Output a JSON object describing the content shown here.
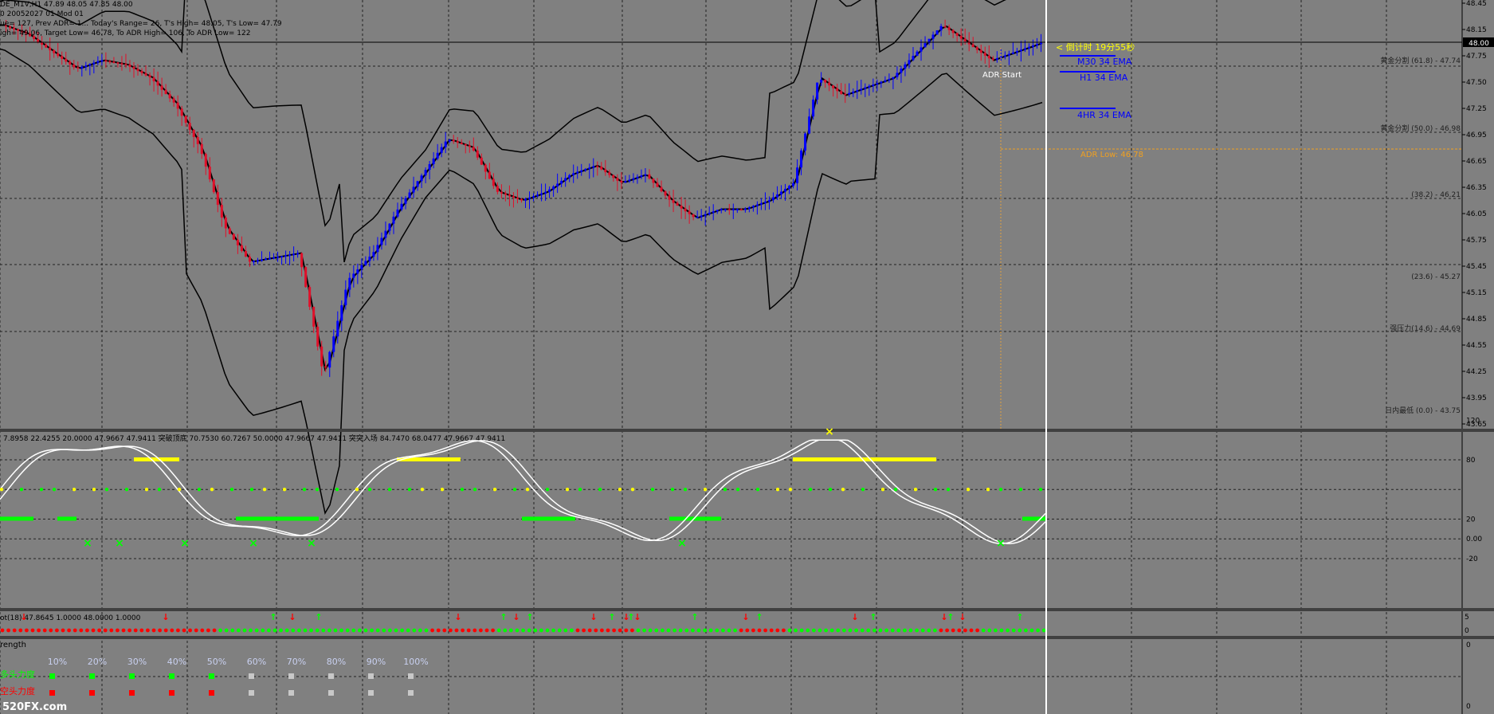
{
  "header": {
    "line1": "DE_M1V,H1  47.89 48.05 47.85 48.00",
    "line2": "0 20052027 01 Mod 01",
    "line3": "ue= 127, Prev ADR= 1... Today's Range= 26, T's High= 48.05, T's Low= 47.79",
    "line4": "igh= 49.06, Target Low= 46.78, To ADR High= 106, To ADR Low= 122"
  },
  "price_axis": {
    "ticks": [
      "48.45",
      "48.15",
      "47.75",
      "47.50",
      "47.25",
      "46.95",
      "46.65",
      "46.35",
      "46.05",
      "45.75",
      "45.45",
      "45.15",
      "44.85",
      "44.55",
      "44.25",
      "43.95",
      "43.65"
    ],
    "current": "48.00"
  },
  "annotations": {
    "countdown": "< 倒计时 19分55秒",
    "m30": "M30 34 EMA",
    "h1": "H1 34 EMA",
    "h4": "4HR 34 EMA",
    "adr_start": "ADR Start",
    "adr_low": "ADR Low: 46.78",
    "fib1": "黄金分割 (61.8) - 47.74",
    "fib2": "黄金分割 (50.0) - 46.98",
    "fib3": "(38.2) - 46.21",
    "fib4": "(23.6) - 45.27",
    "fib5": "强压力(14.6) - 44.69",
    "fib6": "日内最低 (0.0) - 43.75"
  },
  "stoch": {
    "header": "7.8958 22.4255 20.0000 47.9667 47.9411  突破顶底 70.7530 60.7267 50.0000 47.9667 47.9411  突突入场 84.7470 68.0477 47.9667 47.9411",
    "ticks": [
      "120",
      "80",
      "20",
      "0.00",
      "-20"
    ]
  },
  "dots": {
    "header": "ot(18) 47.8645 1.0000 48.0000 1.0000",
    "ticks": [
      "5",
      "0"
    ]
  },
  "strength": {
    "title": "rength",
    "percents": [
      "10%",
      "20%",
      "30%",
      "40%",
      "50%",
      "60%",
      "70%",
      "80%",
      "90%",
      "100%"
    ],
    "bull_label": "多头力度",
    "bear_label": "空头力度",
    "tick_top": "0",
    "tick_bottom": "0",
    "bull_colors": [
      "#00ff00",
      "#00ff00",
      "#00ff00",
      "#00ff00",
      "#00ff00",
      "#c8c8c8",
      "#c8c8c8",
      "#c8c8c8",
      "#c8c8c8",
      "#c8c8c8"
    ],
    "bear_colors": [
      "#ff0000",
      "#ff0000",
      "#ff0000",
      "#ff0000",
      "#ff0000",
      "#c8c8c8",
      "#c8c8c8",
      "#c8c8c8",
      "#c8c8c8",
      "#c8c8c8"
    ]
  },
  "watermark": "520FX.com",
  "colors": {
    "bull": "#0000ff",
    "bear": "#e0102a",
    "band": "#000000",
    "stoch": "#ffffff",
    "green": "#00ff00",
    "yellow": "#ffff00",
    "red": "#ff0000"
  },
  "chart_data": {
    "type": "candlestick",
    "series": [
      {
        "name": "price_close",
        "values": [
          48.2,
          48.1,
          47.9,
          47.7,
          47.8,
          47.75,
          47.6,
          47.3,
          46.8,
          45.9,
          45.5,
          45.55,
          45.6,
          44.2,
          45.3,
          45.6,
          46.1,
          46.5,
          46.9,
          46.8,
          46.3,
          46.2,
          46.3,
          46.5,
          46.6,
          46.4,
          46.5,
          46.2,
          46.0,
          46.1,
          46.1,
          46.2,
          46.4,
          47.6,
          47.4,
          47.5,
          47.6,
          47.9,
          48.2,
          48.0,
          47.8,
          47.9,
          48.0
        ]
      }
    ],
    "ylim": [
      43.65,
      48.45
    ]
  }
}
